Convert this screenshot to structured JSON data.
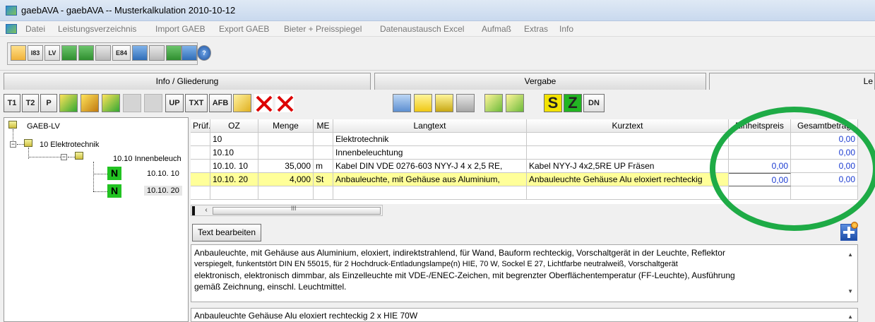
{
  "window": {
    "title": "gaebAVA - gaebAVA  -- Musterkalkulation 2010-10-12"
  },
  "menu": [
    "Datei",
    "Leistungsverzeichnis",
    "Import GAEB",
    "Export GAEB",
    "Bieter + Preisspiegel",
    "Datenaustausch Excel",
    "Aufmaß",
    "Extras",
    "Info"
  ],
  "toolbar1": {
    "b83": "I83",
    "lv": "LV",
    "e84": "E84"
  },
  "tabs": [
    "Info / Gliederung",
    "Vergabe",
    "Le"
  ],
  "toolbar2": {
    "t1": "T1",
    "t2": "T2",
    "p": "P",
    "up": "UP",
    "txt": "TXT",
    "afb": "AFB",
    "s": "S",
    "z": "Z",
    "dn": "DN"
  },
  "tree": {
    "root": "GAEB-LV",
    "level1": "10 Elektrotechnik",
    "level2": "10.10 Innenbeleuch",
    "items": [
      "10.10. 10",
      "10.10. 20"
    ],
    "badge": "N"
  },
  "grid": {
    "headers": [
      "Prüf.",
      "OZ",
      "Menge",
      "ME",
      "Langtext",
      "Kurztext",
      "Einheitspreis",
      "Gesamtbetrag"
    ],
    "rows": [
      {
        "pruef": "",
        "oz": "10",
        "menge": "",
        "me": "",
        "langtext": "Elektrotechnik",
        "kurztext": "",
        "ep": "",
        "gb": "0,00"
      },
      {
        "pruef": "",
        "oz": "10.10",
        "menge": "",
        "me": "",
        "langtext": "Innenbeleuchtung",
        "kurztext": "",
        "ep": "",
        "gb": "0,00"
      },
      {
        "pruef": "",
        "oz": "10.10. 10",
        "menge": "35,000",
        "me": "m",
        "langtext": "Kabel DIN VDE 0276-603 NYY-J 4 x 2,5 RE,",
        "kurztext": "Kabel NYY-J 4x2,5RE UP Fräsen",
        "ep": "0,00",
        "gb": "0,00"
      },
      {
        "pruef": "",
        "oz": "10.10. 20",
        "menge": "4,000",
        "me": "St",
        "langtext": "Anbauleuchte, mit Gehäuse aus Aluminium,",
        "kurztext": "Anbauleuchte Gehäuse Alu eloxiert rechteckig",
        "ep": "0,00",
        "gb": "0,00"
      }
    ],
    "selected_row": 3,
    "scroll_grip": "III"
  },
  "edit_button": "Text bearbeiten",
  "longtext": {
    "line1": "Anbauleuchte, mit Gehäuse aus Aluminium, eloxiert, indirektstrahlend, für Wand, Bauform rechteckig, Vorschaltgerät in der Leuchte, Reflektor",
    "line2": "verspiegelt, funkentstört DIN EN 55015, für 2 Hochdruck-Entladungslampe(n) HIE, 70 W, Sockel E 27, Lichtfarbe neutralweiß, Vorschaltgerät",
    "line3": "elektronisch, elektronisch dimmbar, als Einzelleuchte mit VDE-/ENEC-Zeichen, mit begrenzter Oberflächentemperatur (FF-Leuchte), Ausführung",
    "line4": "gemäß Zeichnung, einschl. Leuchtmittel."
  },
  "shorttext": "Anbauleuchte Gehäuse Alu eloxiert rechteckig 2 x HIE 70W",
  "colors": {
    "highlight_ellipse": "#1eab46",
    "selected_row": "#ffff99",
    "price_blue": "#1a3ad0",
    "badge_green": "#22c322"
  }
}
